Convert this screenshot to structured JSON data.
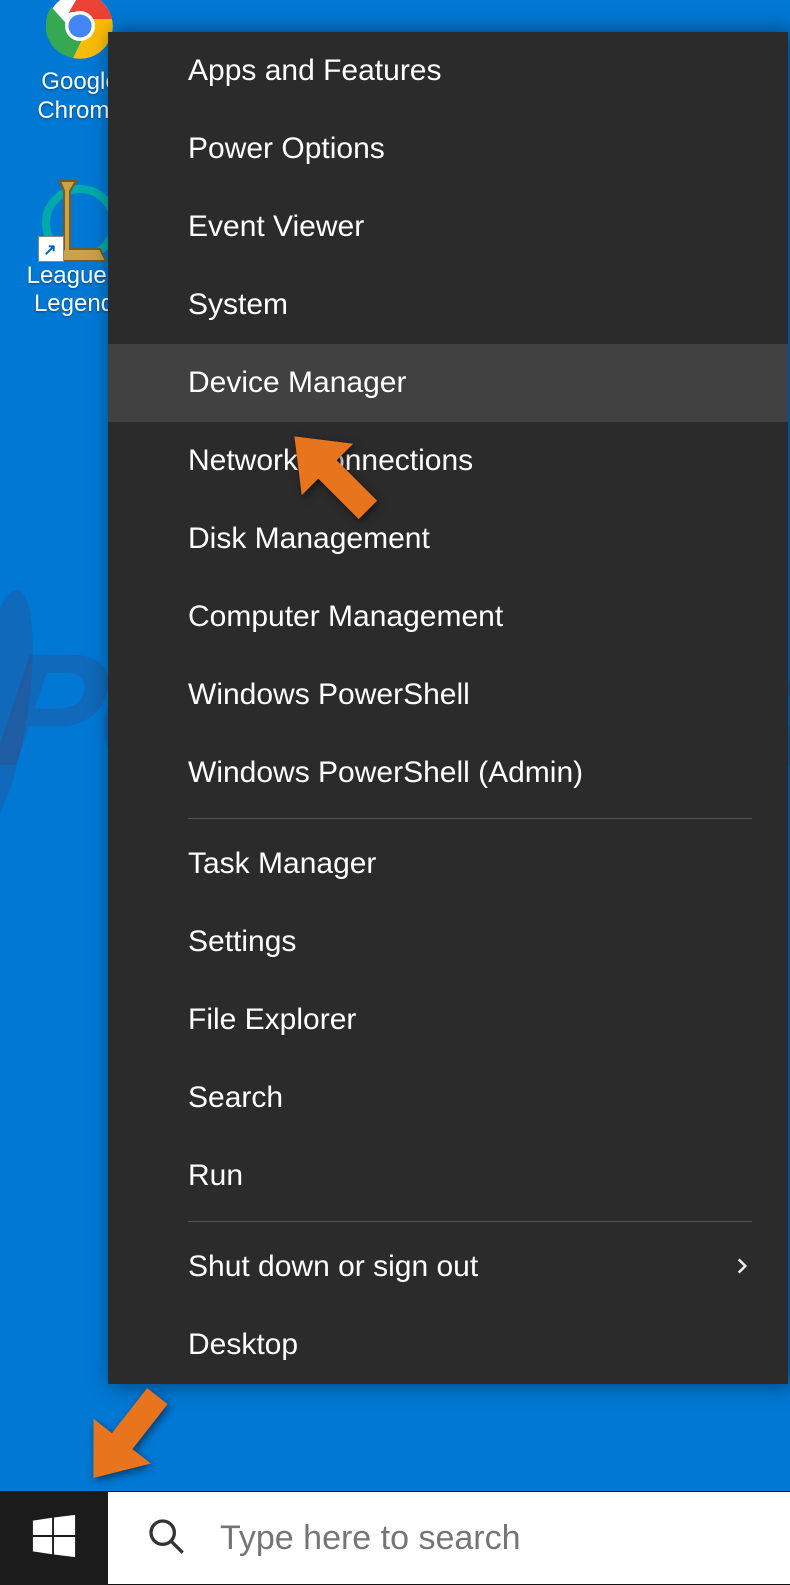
{
  "desktop": {
    "icons": [
      {
        "label": "Google Chrome",
        "kind": "chrome"
      },
      {
        "label": "League of Legends",
        "kind": "lol"
      }
    ]
  },
  "context_menu": {
    "sections": [
      [
        "Apps and Features",
        "Power Options",
        "Event Viewer",
        "System",
        "Device Manager",
        "Network Connections",
        "Disk Management",
        "Computer Management",
        "Windows PowerShell",
        "Windows PowerShell (Admin)"
      ],
      [
        "Task Manager",
        "Settings",
        "File Explorer",
        "Search",
        "Run"
      ],
      [
        "Shut down or sign out",
        "Desktop"
      ]
    ],
    "hovered": "Device Manager",
    "submenu_items": [
      "Shut down or sign out"
    ]
  },
  "taskbar": {
    "search_placeholder": "Type here to search"
  },
  "watermark": {
    "text": "PCrisk.com"
  },
  "annotations": {
    "arrows_point_to": [
      "Device Manager",
      "Start button"
    ]
  }
}
